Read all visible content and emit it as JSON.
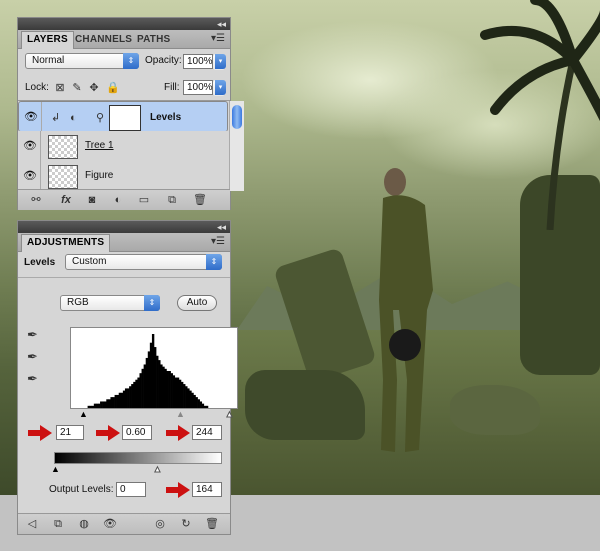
{
  "layers_panel": {
    "tabs": [
      "LAYERS",
      "CHANNELS",
      "PATHS"
    ],
    "blend_mode": "Normal",
    "opacity_label": "Opacity:",
    "opacity_value": "100%",
    "lock_label": "Lock:",
    "fill_label": "Fill:",
    "fill_value": "100%",
    "layers": [
      {
        "name": "Levels",
        "selected": true,
        "type": "adjustment"
      },
      {
        "name": "Tree 1",
        "selected": false,
        "type": "image"
      },
      {
        "name": "Figure",
        "selected": false,
        "type": "image"
      }
    ],
    "footer_icons": [
      "link-icon",
      "fx-icon",
      "mask-icon",
      "adjustment-icon",
      "folder-icon",
      "new-layer-icon",
      "trash-icon"
    ]
  },
  "adjustments_panel": {
    "tab": "ADJUSTMENTS",
    "preset_label": "Levels",
    "preset_value": "Custom",
    "channel_value": "RGB",
    "auto_button": "Auto",
    "input_black": "21",
    "input_gamma": "0.60",
    "input_white": "244",
    "output_label": "Output Levels:",
    "output_black": "0",
    "output_white": "164",
    "histogram": [
      0,
      0,
      0,
      0,
      0,
      0,
      0,
      0,
      1,
      1,
      1,
      2,
      2,
      2,
      3,
      3,
      3,
      4,
      4,
      5,
      5,
      6,
      6,
      7,
      7,
      8,
      9,
      9,
      10,
      11,
      12,
      13,
      14,
      16,
      18,
      20,
      23,
      26,
      30,
      34,
      28,
      24,
      22,
      20,
      19,
      18,
      17,
      17,
      16,
      15,
      14,
      14,
      13,
      12,
      11,
      10,
      9,
      8,
      7,
      6,
      5,
      4,
      3,
      2,
      1,
      1,
      0,
      0,
      0,
      0,
      0,
      0,
      0,
      0,
      0,
      0,
      0,
      0,
      0,
      0
    ]
  },
  "colors": {
    "accent": "#2f6cc9",
    "selected_row": "#b5cff3",
    "arrow": "#c11111"
  }
}
